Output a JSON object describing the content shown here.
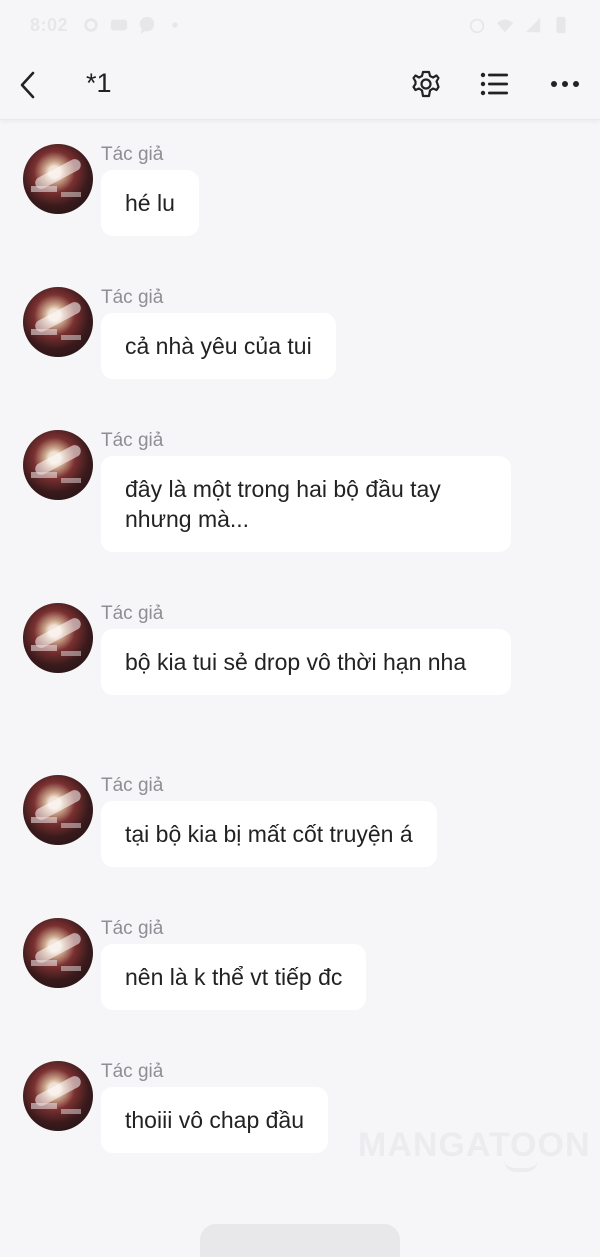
{
  "status_bar": {
    "time": "8:02"
  },
  "header": {
    "title": "*1"
  },
  "messages": [
    {
      "author": "Tác giả",
      "text": "hé lu"
    },
    {
      "author": "Tác giả",
      "text": "cả nhà yêu của tui"
    },
    {
      "author": "Tác giả",
      "text": "đây là một trong hai bộ đầu tay nhưng mà..."
    },
    {
      "author": "Tác giả",
      "text": "bộ kia tui sẻ drop vô thời hạn nha"
    },
    {
      "author": "Tác giả",
      "text": "tại bộ kia bị mất cốt truyện á"
    },
    {
      "author": "Tác giả",
      "text": "nên là k thể vt tiếp đc"
    },
    {
      "author": "Tác giả",
      "text": "thoiii vô chap đầu"
    }
  ],
  "watermark": "MANGATOON",
  "icons": {
    "back": "back-arrow-icon",
    "settings": "gear-icon",
    "list": "list-icon",
    "more": "more-dots-icon"
  }
}
